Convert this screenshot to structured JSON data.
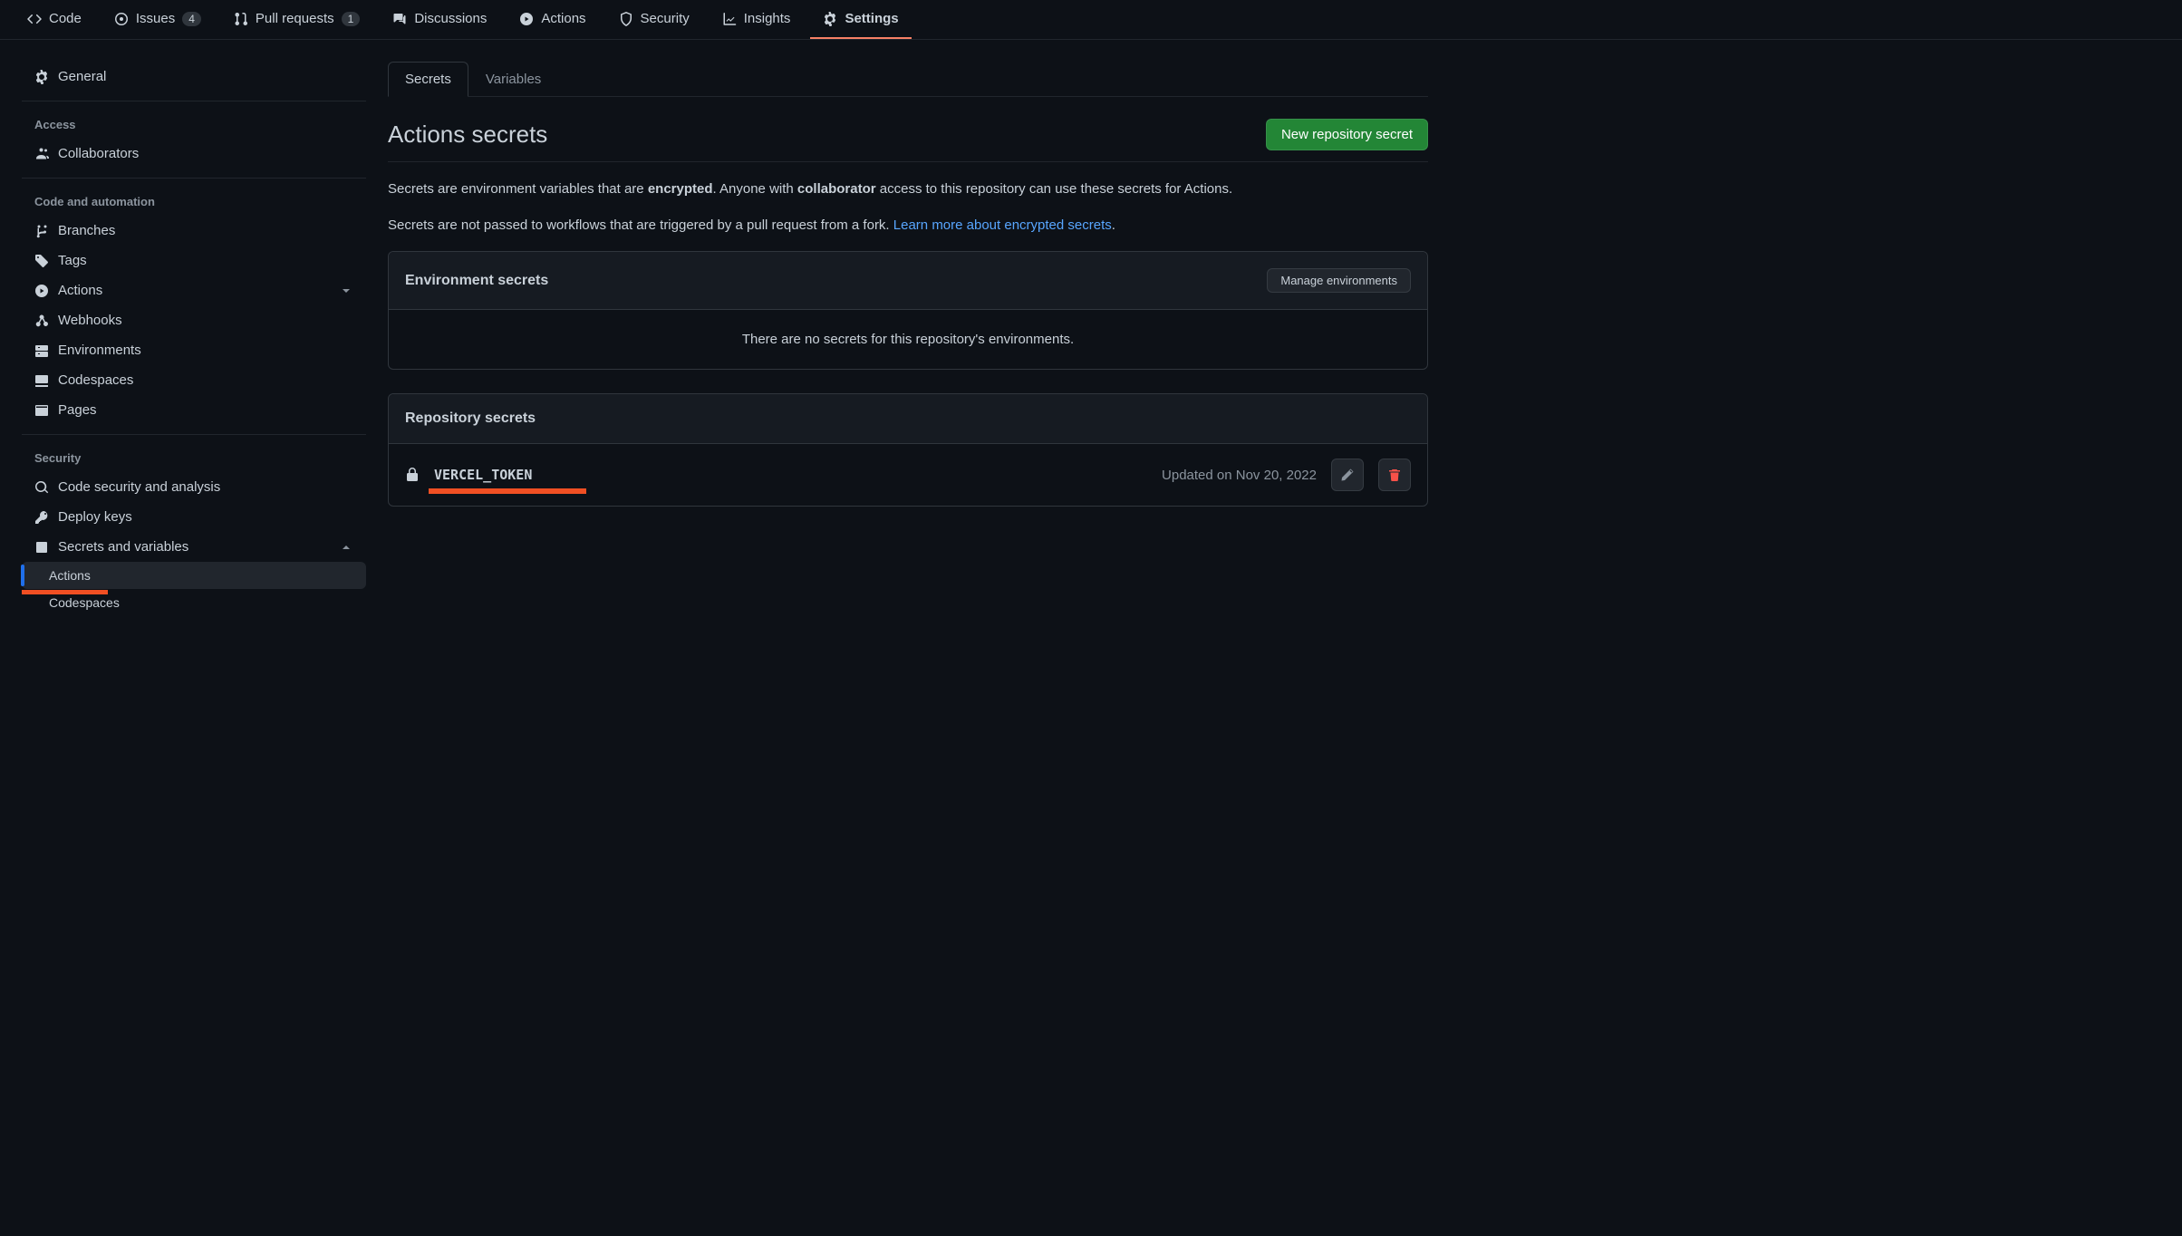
{
  "topnav": {
    "code": "Code",
    "issues": "Issues",
    "issues_count": "4",
    "pulls": "Pull requests",
    "pulls_count": "1",
    "discussions": "Discussions",
    "actions": "Actions",
    "security": "Security",
    "insights": "Insights",
    "settings": "Settings"
  },
  "sidebar": {
    "general": "General",
    "access_title": "Access",
    "collaborators": "Collaborators",
    "code_auto_title": "Code and automation",
    "branches": "Branches",
    "tags": "Tags",
    "actions": "Actions",
    "webhooks": "Webhooks",
    "environments": "Environments",
    "codespaces": "Codespaces",
    "pages": "Pages",
    "security_title": "Security",
    "code_security": "Code security and analysis",
    "deploy_keys": "Deploy keys",
    "secrets_vars": "Secrets and variables",
    "sub_actions": "Actions",
    "sub_codespaces": "Codespaces"
  },
  "tabs": {
    "secrets": "Secrets",
    "variables": "Variables"
  },
  "page": {
    "title": "Actions secrets",
    "new_secret": "New repository secret",
    "desc1_a": "Secrets are environment variables that are ",
    "desc1_b": "encrypted",
    "desc1_c": ". Anyone with ",
    "desc1_d": "collaborator",
    "desc1_e": " access to this repository can use these secrets for Actions.",
    "desc2_a": "Secrets are not passed to workflows that are triggered by a pull request from a fork. ",
    "desc2_link": "Learn more about encrypted secrets",
    "desc2_b": "."
  },
  "env_panel": {
    "title": "Environment secrets",
    "manage": "Manage environments",
    "empty": "There are no secrets for this repository's environments."
  },
  "repo_panel": {
    "title": "Repository secrets",
    "secrets": [
      {
        "name": "VERCEL_TOKEN",
        "updated": "Updated on Nov 20, 2022"
      }
    ]
  }
}
